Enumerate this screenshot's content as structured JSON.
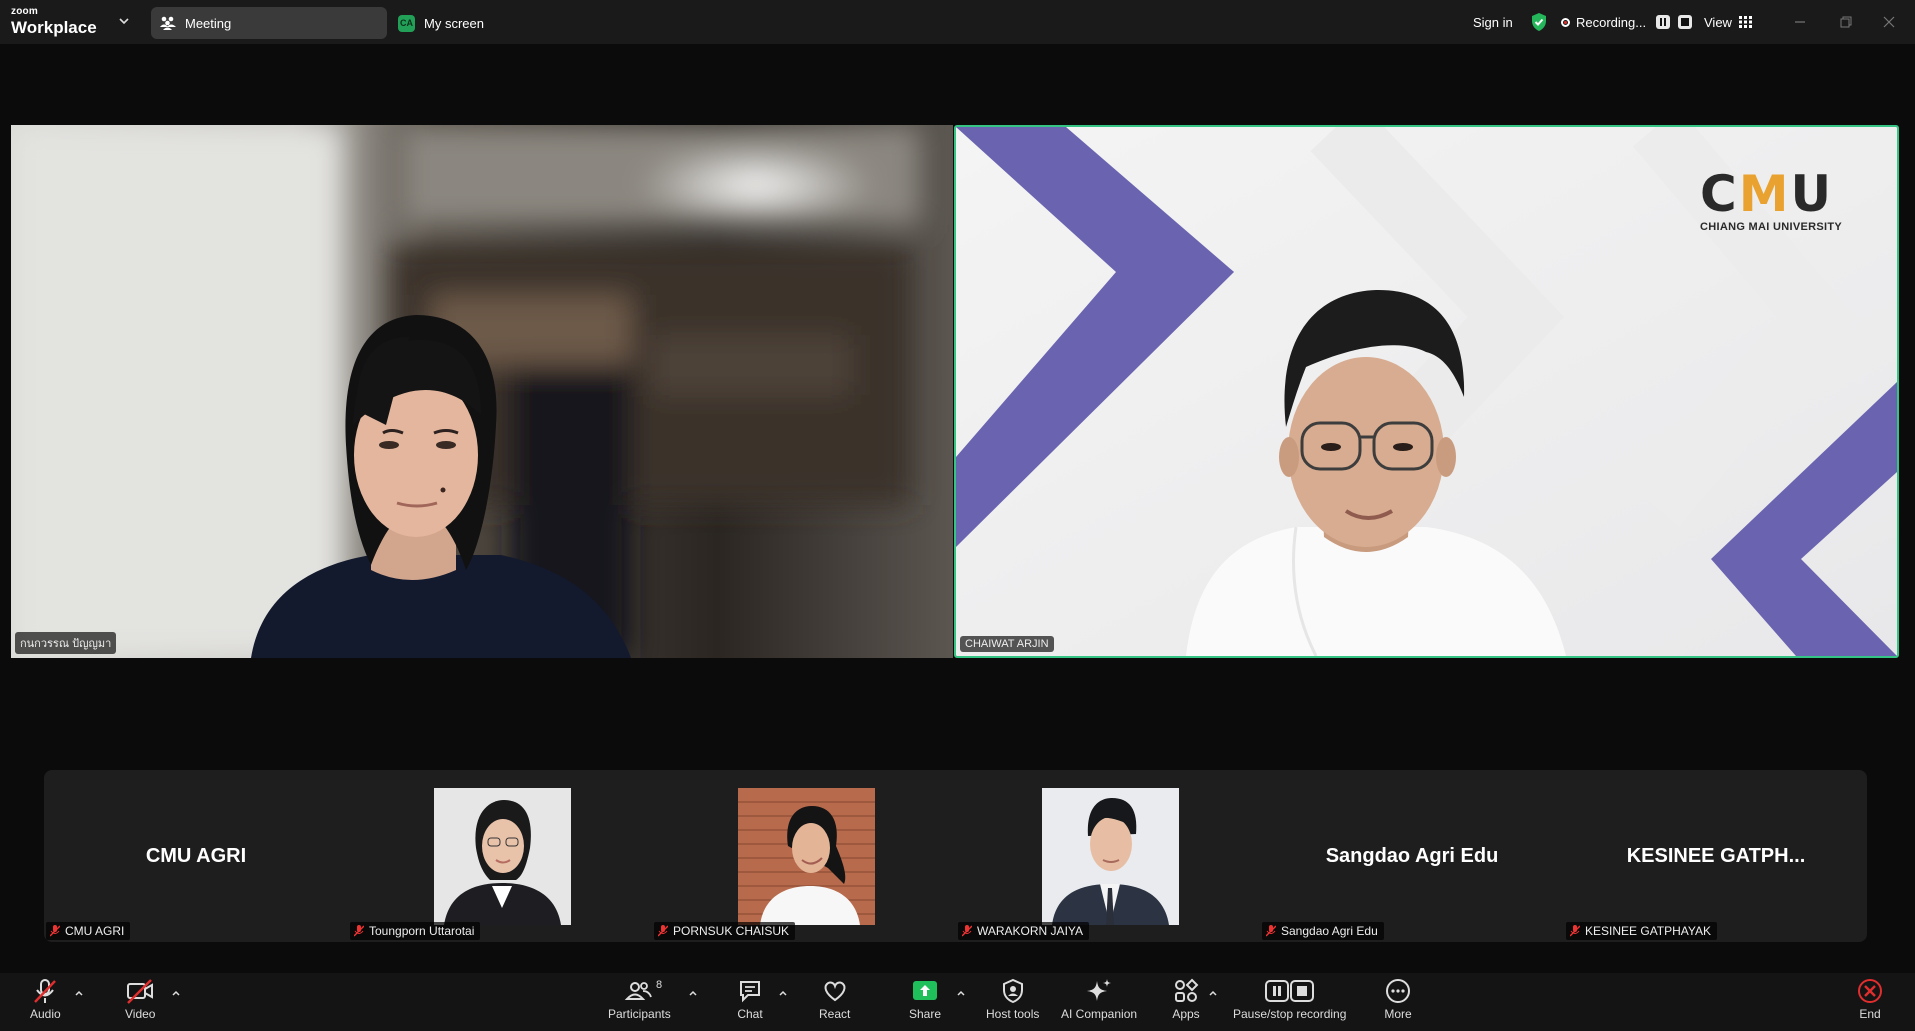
{
  "window": {
    "brand_top": "zoom",
    "brand_bottom": "Workplace",
    "tab_meeting": "Meeting",
    "tab_screen_badge": "CA",
    "tab_screen": "My screen",
    "sign_in": "Sign in",
    "recording": "Recording...",
    "view": "View"
  },
  "videos": {
    "left_name": "กนกวรรณ ปัญญมา",
    "right_name": "CHAIWAT ARJIN",
    "logo_text_a": "C",
    "logo_text_m": "M",
    "logo_text_u": "U",
    "logo_sub": "CHIANG MAI UNIVERSITY"
  },
  "gallery": {
    "participants": [
      {
        "center": "CMU AGRI",
        "tag": "CMU AGRI"
      },
      {
        "center": "",
        "tag": "Toungporn Uttarotai"
      },
      {
        "center": "",
        "tag": "PORNSUK CHAISUK"
      },
      {
        "center": "",
        "tag": "WARAKORN JAIYA"
      },
      {
        "center": "Sangdao Agri Edu",
        "tag": "Sangdao Agri Edu"
      },
      {
        "center": "KESINEE  GATPH...",
        "tag": "KESINEE GATPHAYAK"
      }
    ]
  },
  "toolbar": {
    "audio": "Audio",
    "video": "Video",
    "participants": "Participants",
    "participants_count": "8",
    "chat": "Chat",
    "react": "React",
    "share": "Share",
    "host_tools": "Host tools",
    "ai_companion": "AI Companion",
    "apps": "Apps",
    "pause_recording": "Pause/stop recording",
    "more": "More",
    "end": "End"
  },
  "colors": {
    "active_speaker_border": "#35c483",
    "share_green": "#1fbf5b",
    "end_red": "#e02e2e",
    "cmu_purple": "#6a64b0",
    "cmu_orange": "#e9a230"
  }
}
